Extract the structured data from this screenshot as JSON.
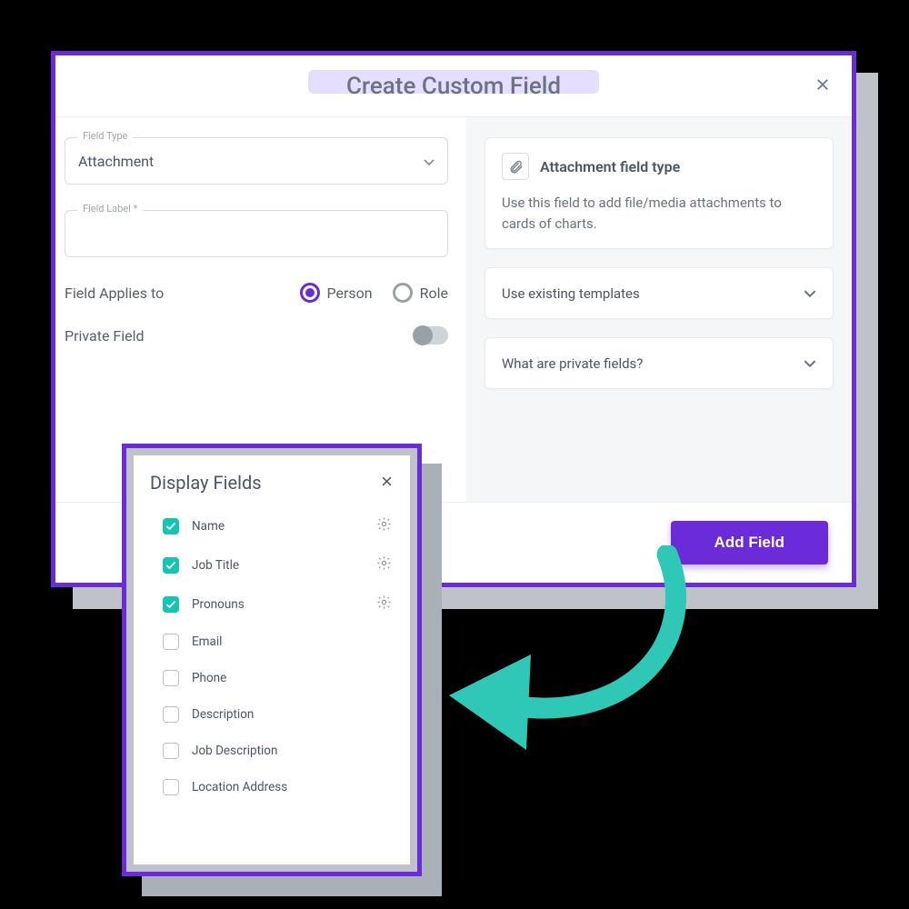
{
  "modal": {
    "title": "Create Custom Field",
    "fieldType": {
      "label": "Field Type",
      "value": "Attachment"
    },
    "fieldLabel": {
      "label": "Field Label *",
      "value": ""
    },
    "appliesTo": {
      "label": "Field Applies to",
      "options": {
        "person": "Person",
        "role": "Role"
      },
      "selected": "person"
    },
    "privateField": {
      "label": "Private Field",
      "enabled": false
    },
    "info": {
      "title": "Attachment field type",
      "desc": "Use this field to add file/media attachments to cards of charts."
    },
    "accordion1": "Use existing templates",
    "accordion2": "What are private fields?",
    "addButton": "Add Field"
  },
  "popup": {
    "title": "Display Fields",
    "items": [
      {
        "name": "Name",
        "checked": true,
        "gear": true
      },
      {
        "name": "Job Title",
        "checked": true,
        "gear": true
      },
      {
        "name": "Pronouns",
        "checked": true,
        "gear": true
      },
      {
        "name": "Email",
        "checked": false,
        "gear": false
      },
      {
        "name": "Phone",
        "checked": false,
        "gear": false
      },
      {
        "name": "Description",
        "checked": false,
        "gear": false
      },
      {
        "name": "Job Description",
        "checked": false,
        "gear": false
      },
      {
        "name": "Location Address",
        "checked": false,
        "gear": false
      }
    ]
  }
}
